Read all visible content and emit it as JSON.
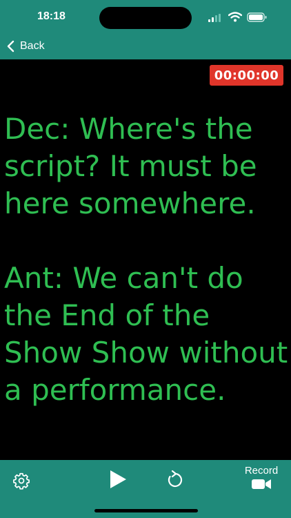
{
  "status_bar": {
    "time": "18:18",
    "icons": [
      "signal-icon",
      "wifi-icon",
      "battery-icon"
    ]
  },
  "nav": {
    "back_label": "Back",
    "back_icon": "chevron-left-icon"
  },
  "timer": {
    "text": "00:00:00"
  },
  "script": {
    "text": "Dec: Where's the script? It must be here somewhere.\n\nAnt: We can't do the End of the Show Show without a performance."
  },
  "toolbar": {
    "settings_icon": "gear-icon",
    "play_icon": "play-icon",
    "restart_icon": "restart-icon",
    "record_label": "Record",
    "record_icon": "video-camera-icon"
  },
  "colors": {
    "accent": "#1f8a7a",
    "script_text": "#2fbe52",
    "timer_bg": "#e0352a",
    "background": "#000000"
  }
}
